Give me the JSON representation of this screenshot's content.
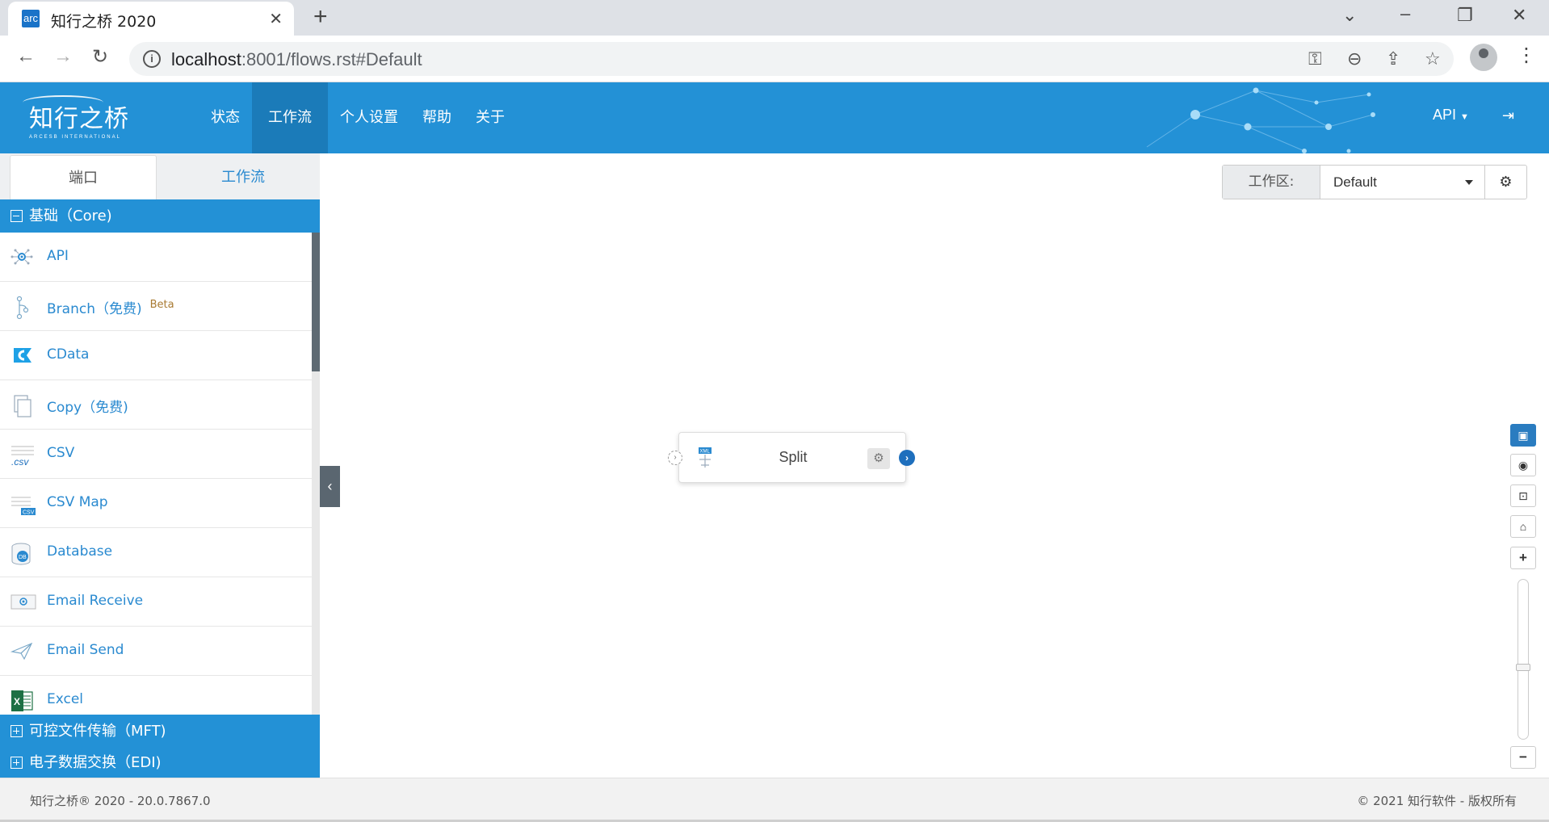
{
  "browser": {
    "tab_title": "知行之桥 2020",
    "favicon_text": "arc",
    "url_host": "localhost",
    "url_rest": ":8001/flows.rst#Default"
  },
  "header": {
    "logo_text": "知行之桥",
    "logo_sub": "ARCESB INTERNATIONAL",
    "nav": [
      "状态",
      "工作流",
      "个人设置",
      "帮助",
      "关于"
    ],
    "active_nav": "工作流",
    "api_label": "API",
    "accent_color": "#2391d6"
  },
  "panel": {
    "tabs": [
      "端口",
      "工作流"
    ],
    "active_tab": "端口",
    "group_core": "基础（Core)",
    "items": [
      {
        "label": "API",
        "icon": "api-icon"
      },
      {
        "label": "Branch（免费)",
        "badge": "Beta",
        "icon": "branch-icon"
      },
      {
        "label": "CData",
        "icon": "cdata-icon"
      },
      {
        "label": "Copy（免费)",
        "icon": "copy-icon"
      },
      {
        "label": "CSV",
        "icon": "csv-icon"
      },
      {
        "label": "CSV Map",
        "icon": "csv-map-icon"
      },
      {
        "label": "Database",
        "icon": "database-icon"
      },
      {
        "label": "Email Receive",
        "icon": "email-receive-icon"
      },
      {
        "label": "Email Send",
        "icon": "email-send-icon"
      },
      {
        "label": "Excel",
        "icon": "excel-icon"
      }
    ],
    "group_mft": "可控文件传输（MFT)",
    "group_edi": "电子数据交换（EDI)"
  },
  "workspace": {
    "label": "工作区:",
    "value": "Default"
  },
  "canvas": {
    "node_label": "Split",
    "node_icon_text": "XML"
  },
  "footer": {
    "left": "知行之桥® 2020 - 20.0.7867.0",
    "right": "© 2021 知行软件 - 版权所有"
  }
}
